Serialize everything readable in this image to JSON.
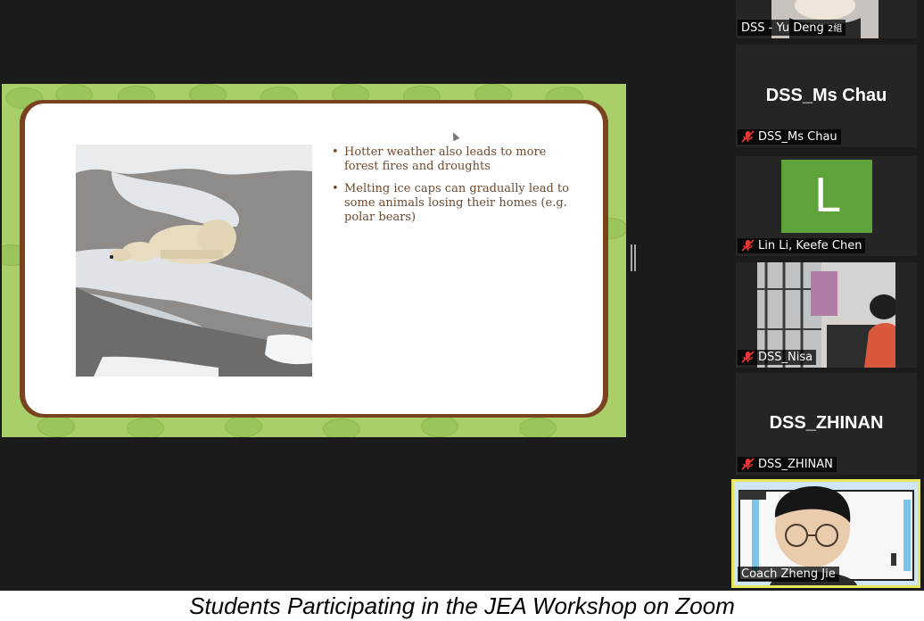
{
  "slide": {
    "bullets": [
      "Hotter weather also leads to more forest fires and droughts",
      "Melting ice caps can gradually lead to some animals losing their homes (e.g. polar bears)"
    ]
  },
  "participants": [
    {
      "label": "DSS - Yu Deng",
      "tag": "2組",
      "muted": false
    },
    {
      "display_name": "DSS_Ms Chau",
      "label": "DSS_Ms Chau",
      "muted": true
    },
    {
      "avatar_letter": "L",
      "label": "Lin Li, Keefe Chen",
      "muted": true
    },
    {
      "label": "DSS_Nisa",
      "muted": true
    },
    {
      "display_name": "DSS_ZHINAN",
      "label": "DSS_ZHINAN",
      "muted": true
    },
    {
      "label": "Coach Zheng Jie",
      "muted": false,
      "active_speaker": true
    }
  ],
  "caption": "Students Participating in the JEA Workshop on Zoom",
  "colors": {
    "slide_green": "#a9cf6a",
    "slide_frame_brown": "#7a4320",
    "bullet_text": "#6b4a31",
    "active_speaker_border": "#e6e65c",
    "mute_red": "#e53935"
  }
}
